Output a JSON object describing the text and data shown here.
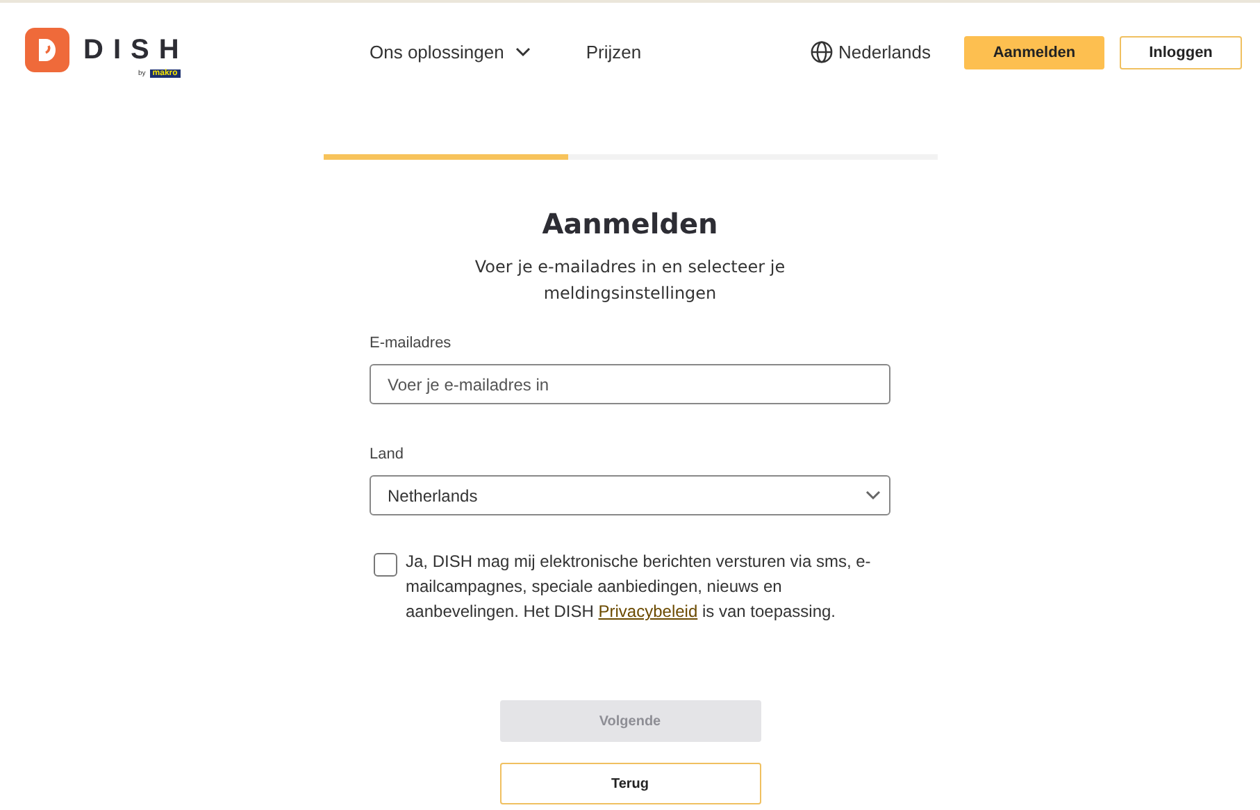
{
  "header": {
    "logo": {
      "name": "DISH",
      "byline": "by",
      "partner": "makro"
    },
    "nav": [
      {
        "label": "Ons oplossingen",
        "dropdown": true
      },
      {
        "label": "Prijzen",
        "dropdown": false
      }
    ],
    "language": "Nederlands",
    "buttons": [
      {
        "label": "Aanmelden",
        "kind": "primary"
      },
      {
        "label": "Inloggen",
        "kind": "outline"
      }
    ]
  },
  "progress": {
    "level": 0.4
  },
  "form": {
    "title": "Aanmelden",
    "subtitle": "Voer je e-mailadres in en selecteer je meldingsinstellingen",
    "fields": [
      {
        "label": "E-mailadres",
        "kind": "text",
        "placeholder": "Voer je e-mailadres in"
      },
      {
        "label": "Land",
        "kind": "select",
        "value": "Netherlands"
      }
    ],
    "consent": {
      "checked": false,
      "before": "Ja, DISH mag mij elektronische berichten versturen via sms, e-mailcampagnes, speciale aanbiedingen, nieuws en aanbevelingen. Het DISH ",
      "link": "Privacybeleid",
      "after": " is van toepassing."
    },
    "buttons": [
      {
        "label": "Volgende",
        "disabled": true
      },
      {
        "label": "Terug",
        "disabled": false
      }
    ]
  }
}
